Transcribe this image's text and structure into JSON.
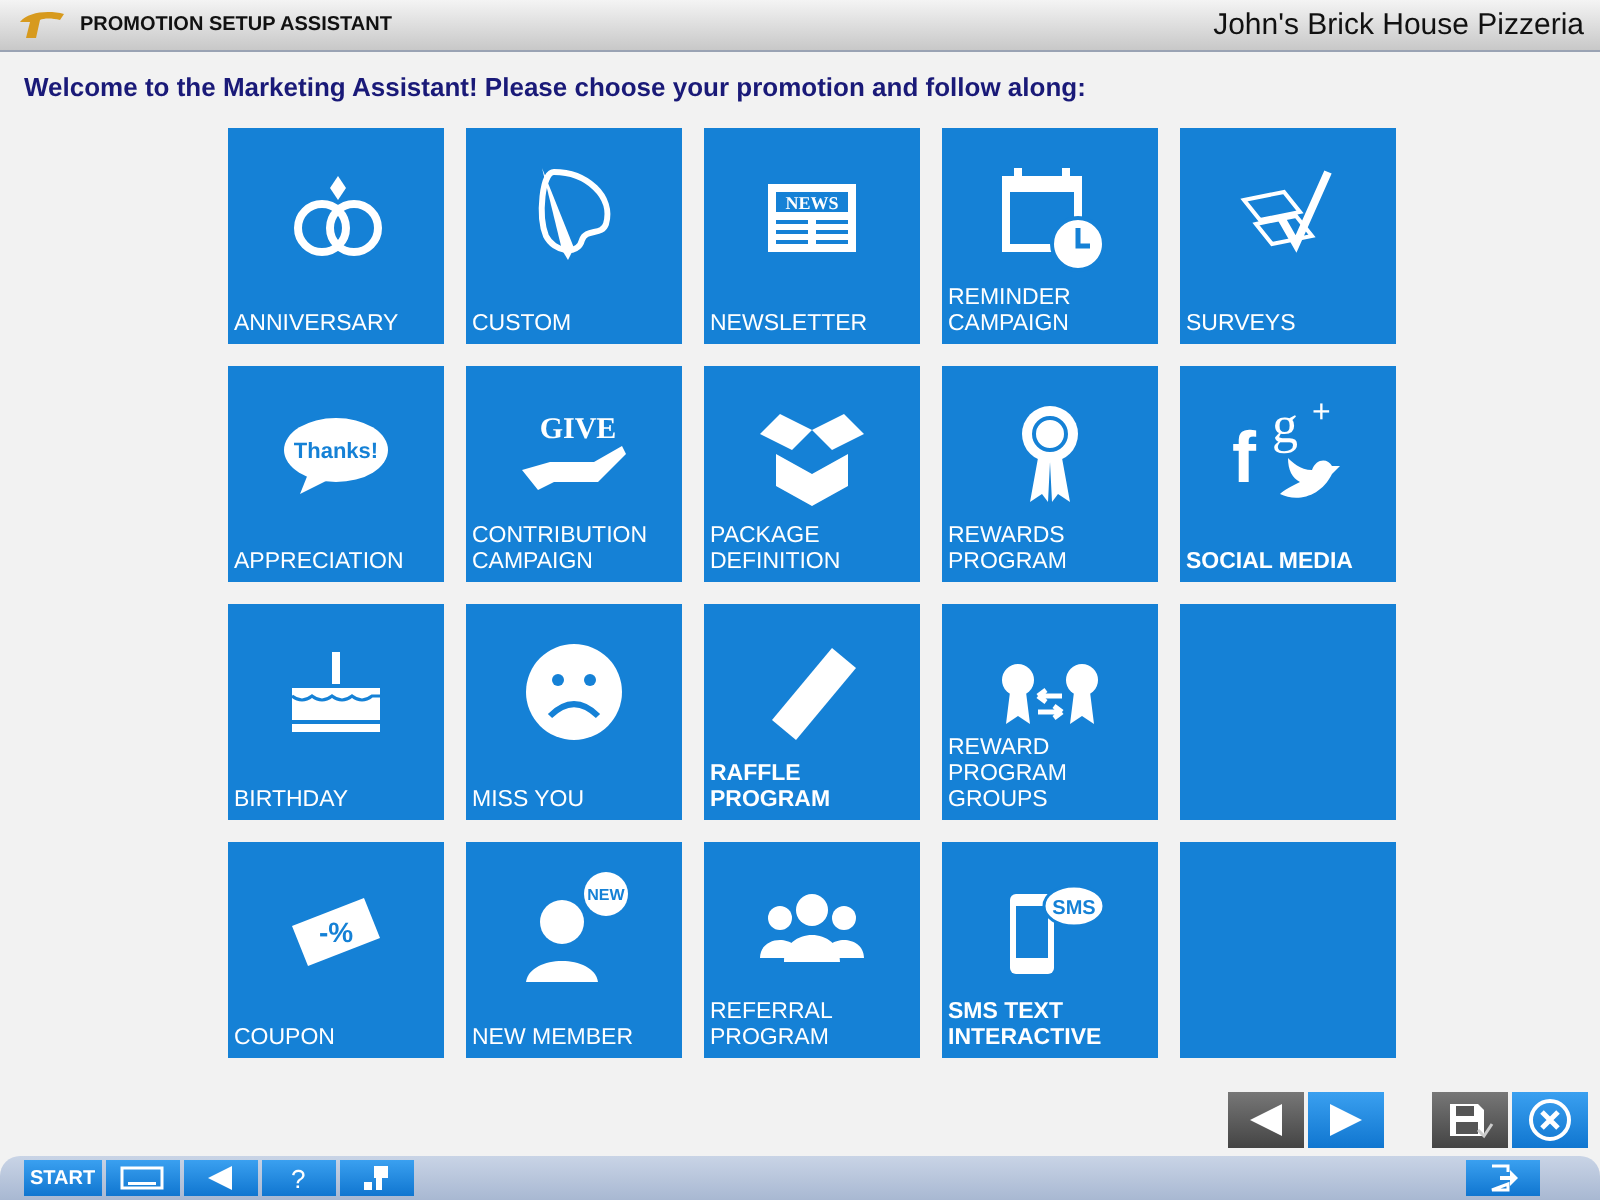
{
  "window": {
    "title": "PROMOTION SETUP ASSISTANT",
    "business": "John's Brick House Pizzeria"
  },
  "welcome": "Welcome to the Marketing Assistant!  Please choose your promotion and follow along:",
  "tiles": [
    {
      "kind": "promo",
      "label": "ANNIVERSARY",
      "bold": false
    },
    {
      "kind": "promo",
      "label": "CUSTOM",
      "bold": false
    },
    {
      "kind": "promo",
      "label": "NEWSLETTER",
      "bold": false,
      "icon_text": [
        "NEWS"
      ]
    },
    {
      "kind": "promo",
      "label": "REMINDER\nCAMPAIGN",
      "bold": false
    },
    {
      "kind": "promo",
      "label": "SURVEYS",
      "bold": false
    },
    {
      "kind": "promo",
      "label": "APPRECIATION",
      "bold": false,
      "icon_text": [
        "Thanks!"
      ]
    },
    {
      "kind": "promo",
      "label": "CONTRIBUTION\nCAMPAIGN",
      "bold": false,
      "icon_text": [
        "GIVE"
      ]
    },
    {
      "kind": "promo",
      "label": "PACKAGE\nDEFINITION",
      "bold": false
    },
    {
      "kind": "promo",
      "label": "REWARDS\nPROGRAM",
      "bold": false
    },
    {
      "kind": "promo",
      "label": "SOCIAL MEDIA",
      "bold": true,
      "icon_text": [
        "f",
        "g",
        "+"
      ]
    },
    {
      "kind": "promo",
      "label": "BIRTHDAY",
      "bold": false
    },
    {
      "kind": "promo",
      "label": "MISS YOU",
      "bold": false
    },
    {
      "kind": "promo",
      "label": "RAFFLE\nPROGRAM",
      "bold": true
    },
    {
      "kind": "promo",
      "label": "REWARD PROGRAM\nGROUPS",
      "bold": false
    },
    {
      "kind": "empty"
    },
    {
      "kind": "promo",
      "label": "COUPON",
      "bold": false,
      "icon_text": [
        "-%"
      ]
    },
    {
      "kind": "promo",
      "label": "NEW MEMBER",
      "bold": false,
      "icon_text": [
        "NEW"
      ]
    },
    {
      "kind": "promo",
      "label": "REFERRAL\nPROGRAM",
      "bold": false
    },
    {
      "kind": "promo",
      "label": "SMS TEXT\nINTERACTIVE",
      "bold": true,
      "icon_text": [
        "SMS"
      ]
    },
    {
      "kind": "empty"
    }
  ],
  "toolbar": {
    "start": "START",
    "help": "?"
  }
}
